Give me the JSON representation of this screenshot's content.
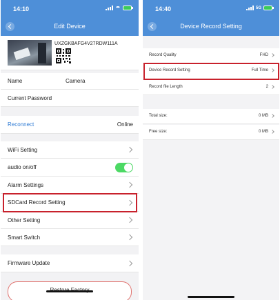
{
  "left": {
    "status": {
      "time": "14:10"
    },
    "nav": {
      "title": "Edit Device"
    },
    "device": {
      "uid": "UXZGKBAFG4V27RDW111A"
    },
    "name": {
      "label": "Name",
      "value": "Camera"
    },
    "password": {
      "label": "Current Password"
    },
    "reconnect": {
      "label": "Reconnect",
      "status": "Online"
    },
    "items": [
      {
        "label": "WiFi Setting"
      },
      {
        "label": "audio on/off",
        "toggle": true
      },
      {
        "label": "Alarm Settings"
      },
      {
        "label": "SDCard Record Setting"
      },
      {
        "label": "Other Setting"
      },
      {
        "label": "Smart Switch"
      }
    ],
    "firmware": {
      "label": "Firmware Update"
    },
    "restore": {
      "label": "Restore Factory"
    },
    "colors": {
      "accent": "#4e8fd8",
      "link": "#2f7bd4",
      "toggle_on": "#4cd964",
      "highlight": "#c8212c"
    }
  },
  "right": {
    "status": {
      "time": "14:40",
      "network": "5G"
    },
    "nav": {
      "title": "Device Record Setting"
    },
    "rows": [
      {
        "label": "Record Quality",
        "value": "FHD"
      },
      {
        "label": "Device Record Setting",
        "value": "Full Time"
      },
      {
        "label": "Record file Length",
        "value": "2"
      }
    ],
    "storage": [
      {
        "label": "Total size:",
        "value": "0 MB"
      },
      {
        "label": "Free size:",
        "value": "0 MB"
      }
    ]
  }
}
